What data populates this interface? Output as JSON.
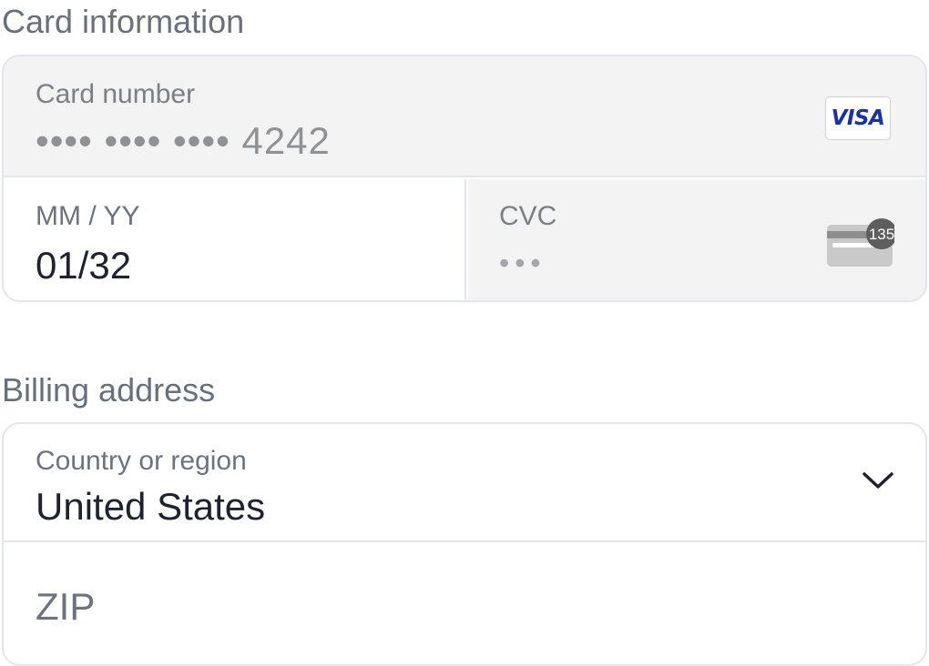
{
  "card_information": {
    "title": "Card information",
    "card_number": {
      "label": "Card number",
      "value": "•••• •••• •••• 4242",
      "brand": "VISA"
    },
    "expiry": {
      "label": "MM / YY",
      "value": "01/32"
    },
    "cvc": {
      "label": "CVC",
      "value": "•••",
      "icon_badge": "135"
    }
  },
  "billing_address": {
    "title": "Billing address",
    "country": {
      "label": "Country or region",
      "value": "United States"
    },
    "zip": {
      "placeholder": "ZIP"
    }
  },
  "colors": {
    "label": "#6c7380",
    "value": "#1f2330",
    "disabled_bg": "#f3f3f3",
    "border": "#e3e6ea",
    "visa_blue": "#1a32a8"
  }
}
